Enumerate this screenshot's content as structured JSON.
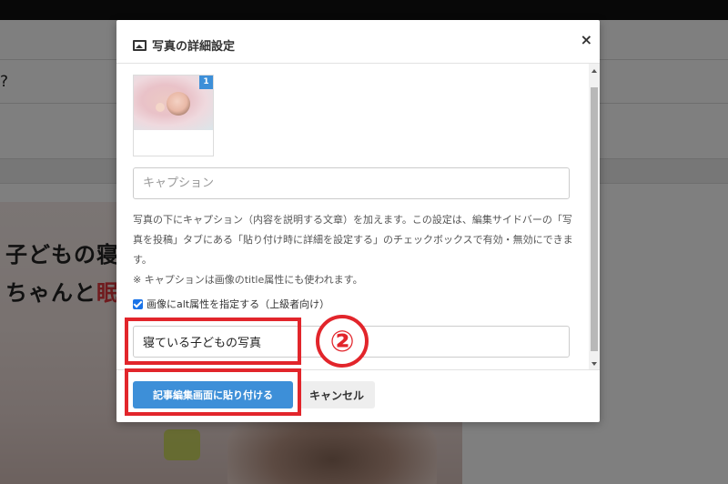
{
  "background": {
    "question_fragment": "?",
    "hero_line1": "子どもの寝",
    "hero_line2_black": "ちゃんと",
    "hero_line2_red": "眠"
  },
  "modal": {
    "title": "写真の詳細設定",
    "title_icon": "image-icon",
    "close_label": "×",
    "thumbnail_badge": "1",
    "caption_placeholder": "キャプション",
    "help_text": "写真の下にキャプション（内容を説明する文章）を加えます。この設定は、編集サイドバーの「写真を投稿」タブにある「貼り付け時に詳細を設定する」のチェックボックスで有効・無効にできます。",
    "help_note": "※ キャプションは画像のtitle属性にも使われます。",
    "alt_checkbox_label": "画像にalt属性を指定する（上級者向け）",
    "alt_checked": true,
    "alt_value": "寝ている子どもの写真",
    "primary_button": "記事編集画面に貼り付ける",
    "cancel_button": "キャンセル"
  },
  "annotation": {
    "step_number": "②",
    "highlight_color": "#e2252b"
  },
  "colors": {
    "primary": "#3d8fd8",
    "checkbox": "#1a73e8"
  }
}
